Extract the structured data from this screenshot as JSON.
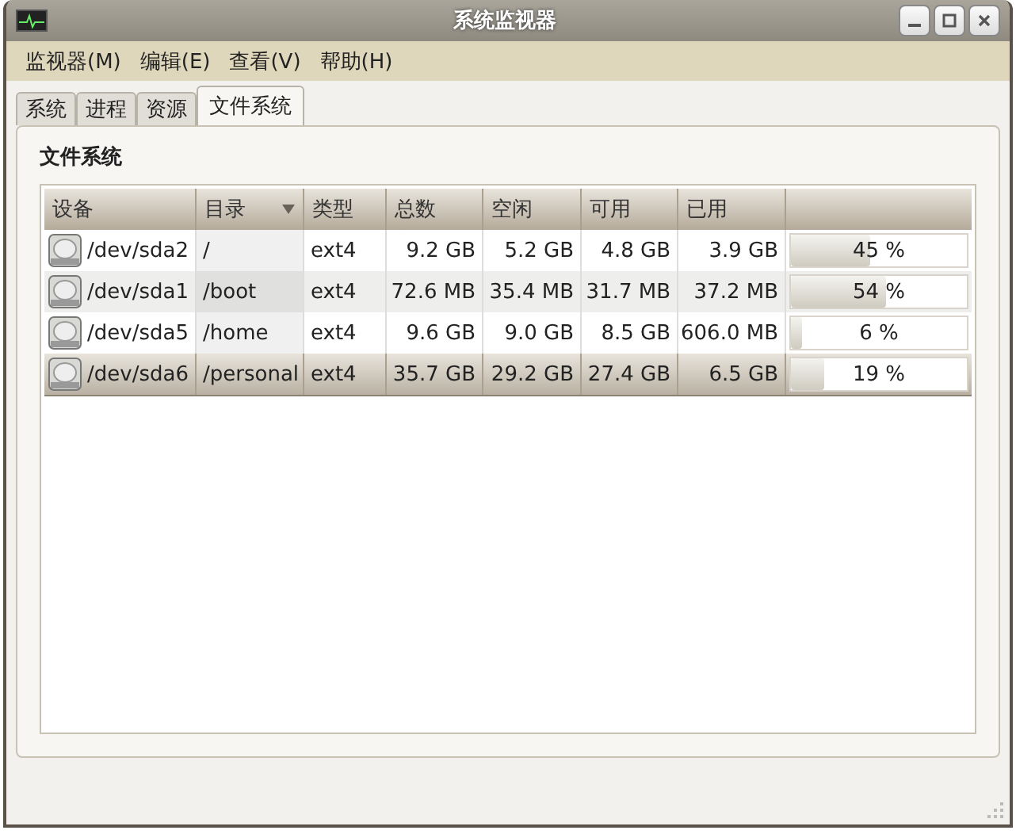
{
  "window": {
    "title": "系统监视器"
  },
  "menu": [
    "监视器(M)",
    "编辑(E)",
    "查看(V)",
    "帮助(H)"
  ],
  "tabs": [
    {
      "label": "系统",
      "selected": false
    },
    {
      "label": "进程",
      "selected": false
    },
    {
      "label": "资源",
      "selected": false
    },
    {
      "label": "文件系统",
      "selected": true
    }
  ],
  "section_title": "文件系统",
  "table": {
    "columns": [
      {
        "label": "设备",
        "sorted": false
      },
      {
        "label": "目录",
        "sorted": true
      },
      {
        "label": "类型",
        "sorted": false
      },
      {
        "label": "总数",
        "sorted": false
      },
      {
        "label": "空闲",
        "sorted": false
      },
      {
        "label": "可用",
        "sorted": false
      },
      {
        "label": "已用",
        "sorted": false
      }
    ],
    "rows": [
      {
        "device": "/dev/sda2",
        "directory": "/",
        "type": "ext4",
        "total": "9.2 GB",
        "free": "5.2 GB",
        "available": "4.8 GB",
        "used": "3.9 GB",
        "level": 0.45,
        "percent": "45 %",
        "selected": false
      },
      {
        "device": "/dev/sda1",
        "directory": "/boot",
        "type": "ext4",
        "total": "72.6 MB",
        "free": "35.4 MB",
        "available": "31.7 MB",
        "used": "37.2 MB",
        "level": 0.54,
        "percent": "54 %",
        "selected": false
      },
      {
        "device": "/dev/sda5",
        "directory": "/home",
        "type": "ext4",
        "total": "9.6 GB",
        "free": "9.0 GB",
        "available": "8.5 GB",
        "used": "606.0 MB",
        "level": 0.06,
        "percent": "6 %",
        "selected": false
      },
      {
        "device": "/dev/sda6",
        "directory": "/personal",
        "type": "ext4",
        "total": "35.7 GB",
        "free": "29.2 GB",
        "available": "27.4 GB",
        "used": "6.5 GB",
        "level": 0.19,
        "percent": "19 %",
        "selected": true
      }
    ]
  }
}
